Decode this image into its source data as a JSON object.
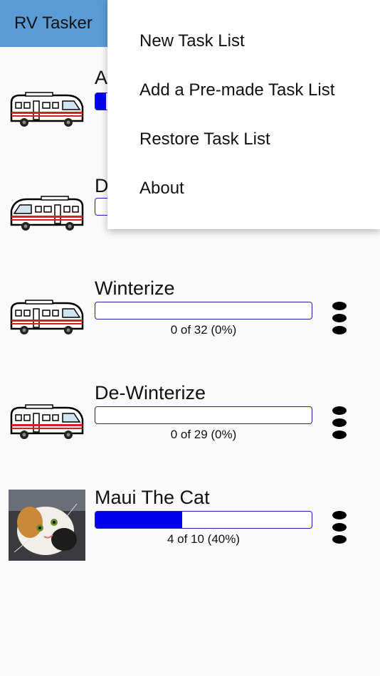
{
  "app": {
    "title": "RV Tasker"
  },
  "colors": {
    "app_bar": "#5b9bd5",
    "progress_fill": "#0000ee",
    "progress_border": "#1f1fb0"
  },
  "lists": [
    {
      "title": "A",
      "icon": "rv-icon",
      "progress_text": "",
      "progress_fraction": 0.05
    },
    {
      "title": "D",
      "icon": "rv-icon",
      "progress_text": "",
      "progress_fraction": 0
    },
    {
      "title": "Winterize",
      "icon": "rv-icon",
      "progress_text": "0 of 32 (0%)",
      "progress_fraction": 0
    },
    {
      "title": "De-Winterize",
      "icon": "rv-icon",
      "progress_text": "0 of 29 (0%)",
      "progress_fraction": 0
    },
    {
      "title": "Maui The Cat",
      "icon": "cat-photo",
      "progress_text": "4 of 10 (40%)",
      "progress_fraction": 0.4
    }
  ],
  "menu": {
    "items": [
      "New Task List",
      "Add a Pre-made Task List",
      "Restore Task List",
      "About"
    ]
  }
}
